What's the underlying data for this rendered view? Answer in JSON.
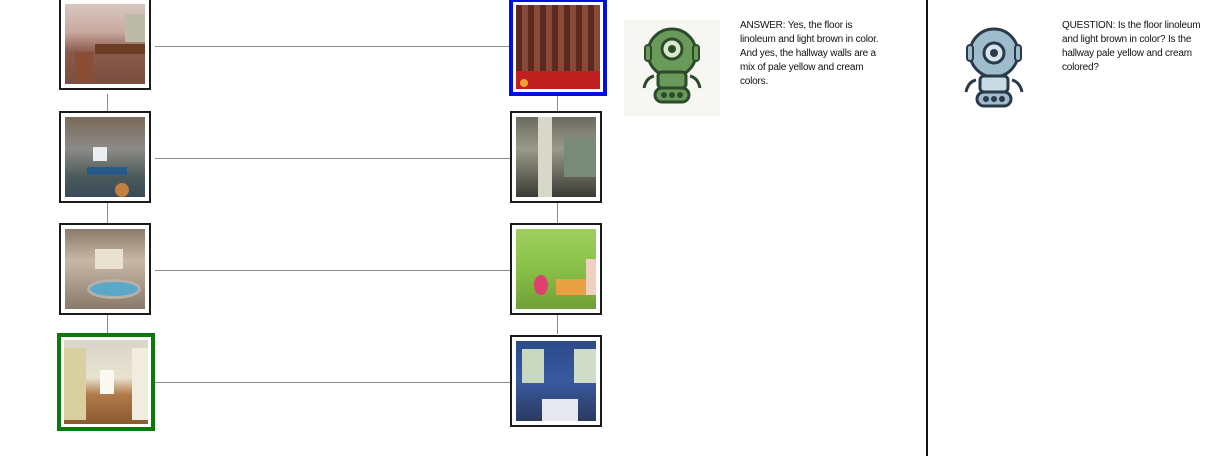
{
  "answer": {
    "label": "ANSWER:",
    "text": "Yes, the floor is linoleum and light brown in color. And yes, the hallway walls are a mix of pale yellow and cream colors."
  },
  "question": {
    "label": "QUESTION:",
    "text": "Is the floor linoleum and light brown in color? Is the hallway pale yellow and cream colored?"
  },
  "colors": {
    "selected_left": "#0a7a0a",
    "selected_right": "#0010e0",
    "answer_bot": "#6a9a5a",
    "question_bot": "#9fbccc"
  },
  "icons": {
    "answer_bot": "robot-icon",
    "question_bot": "robot-icon"
  }
}
